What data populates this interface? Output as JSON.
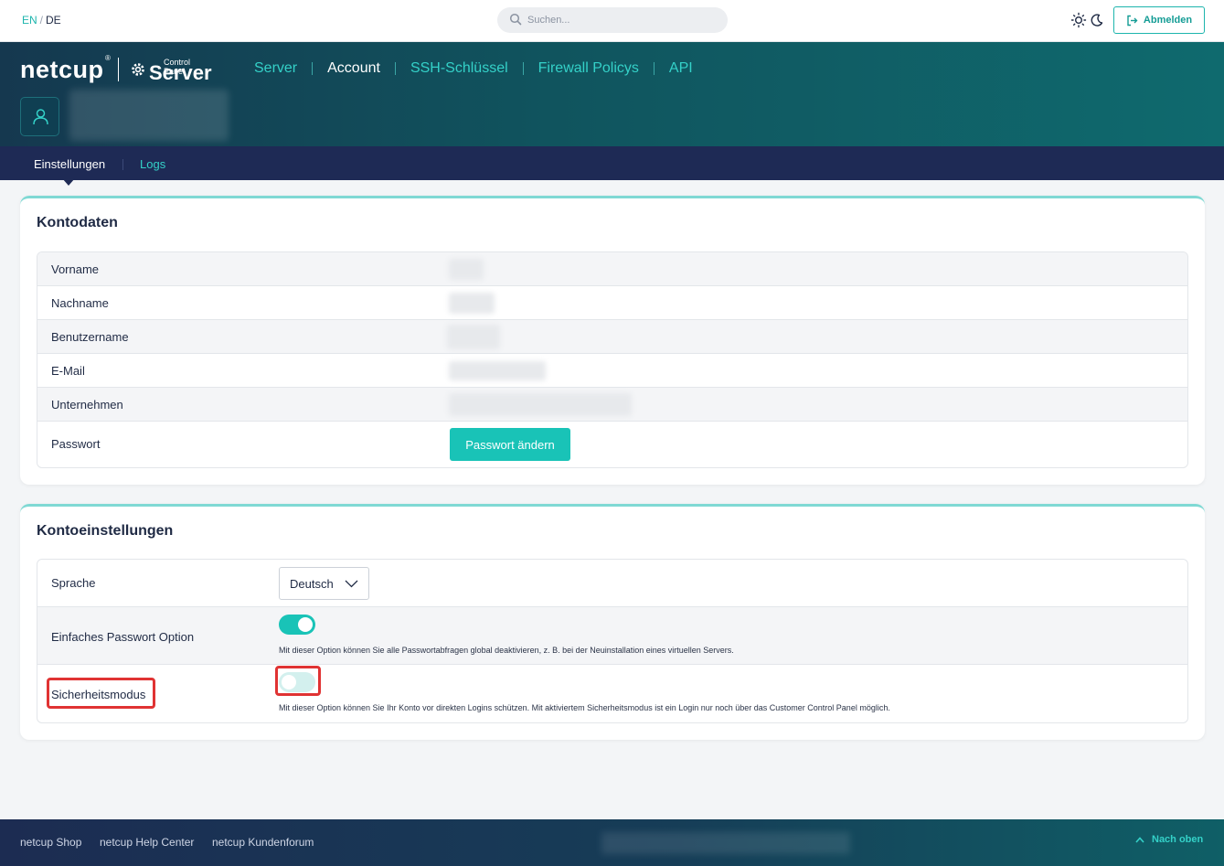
{
  "topbar": {
    "lang_en": "EN",
    "lang_sep": "/",
    "lang_de": "DE",
    "search_placeholder": "Suchen...",
    "logout_label": "Abmelden"
  },
  "header": {
    "brand": "netcup",
    "registered": "®",
    "product_small": "Control Panel",
    "product": "Server",
    "nav": [
      "Server",
      "Account",
      "SSH-Schlüssel",
      "Firewall Policys",
      "API"
    ],
    "active_nav": "Account"
  },
  "subnav": {
    "tabs": [
      "Einstellungen",
      "Logs"
    ],
    "active": "Einstellungen"
  },
  "kontodaten": {
    "title": "Kontodaten",
    "rows": [
      "Vorname",
      "Nachname",
      "Benutzername",
      "E-Mail",
      "Unternehmen",
      "Passwort"
    ],
    "password_button": "Passwort ändern"
  },
  "kontoeinstellungen": {
    "title": "Kontoeinstellungen",
    "language_label": "Sprache",
    "language_value": "Deutsch",
    "easy_pw_label": "Einfaches Passwort Option",
    "easy_pw_enabled": true,
    "easy_pw_desc": "Mit dieser Option können Sie alle Passwortabfragen global deaktivieren, z. B. bei der Neuinstallation eines virtuellen Servers.",
    "security_label": "Sicherheitsmodus",
    "security_enabled": false,
    "security_desc": "Mit dieser Option können Sie Ihr Konto vor direkten Logins schützen. Mit aktiviertem Sicherheitsmodus ist ein Login nur noch über das Customer Control Panel möglich."
  },
  "footer": {
    "links": [
      "netcup Shop",
      "netcup Help Center",
      "netcup Kundenforum"
    ],
    "back_to_top": "Nach oben"
  },
  "colors": {
    "accent": "#19c3b7",
    "nav_active": "#ffffff",
    "subnav_bg": "#1e2a55",
    "highlight": "#e03333"
  },
  "icons": [
    "search-icon",
    "sun-icon",
    "moon-icon",
    "logout-icon",
    "gear-icon",
    "user-icon",
    "chevron-down-icon",
    "chevron-up-icon"
  ]
}
